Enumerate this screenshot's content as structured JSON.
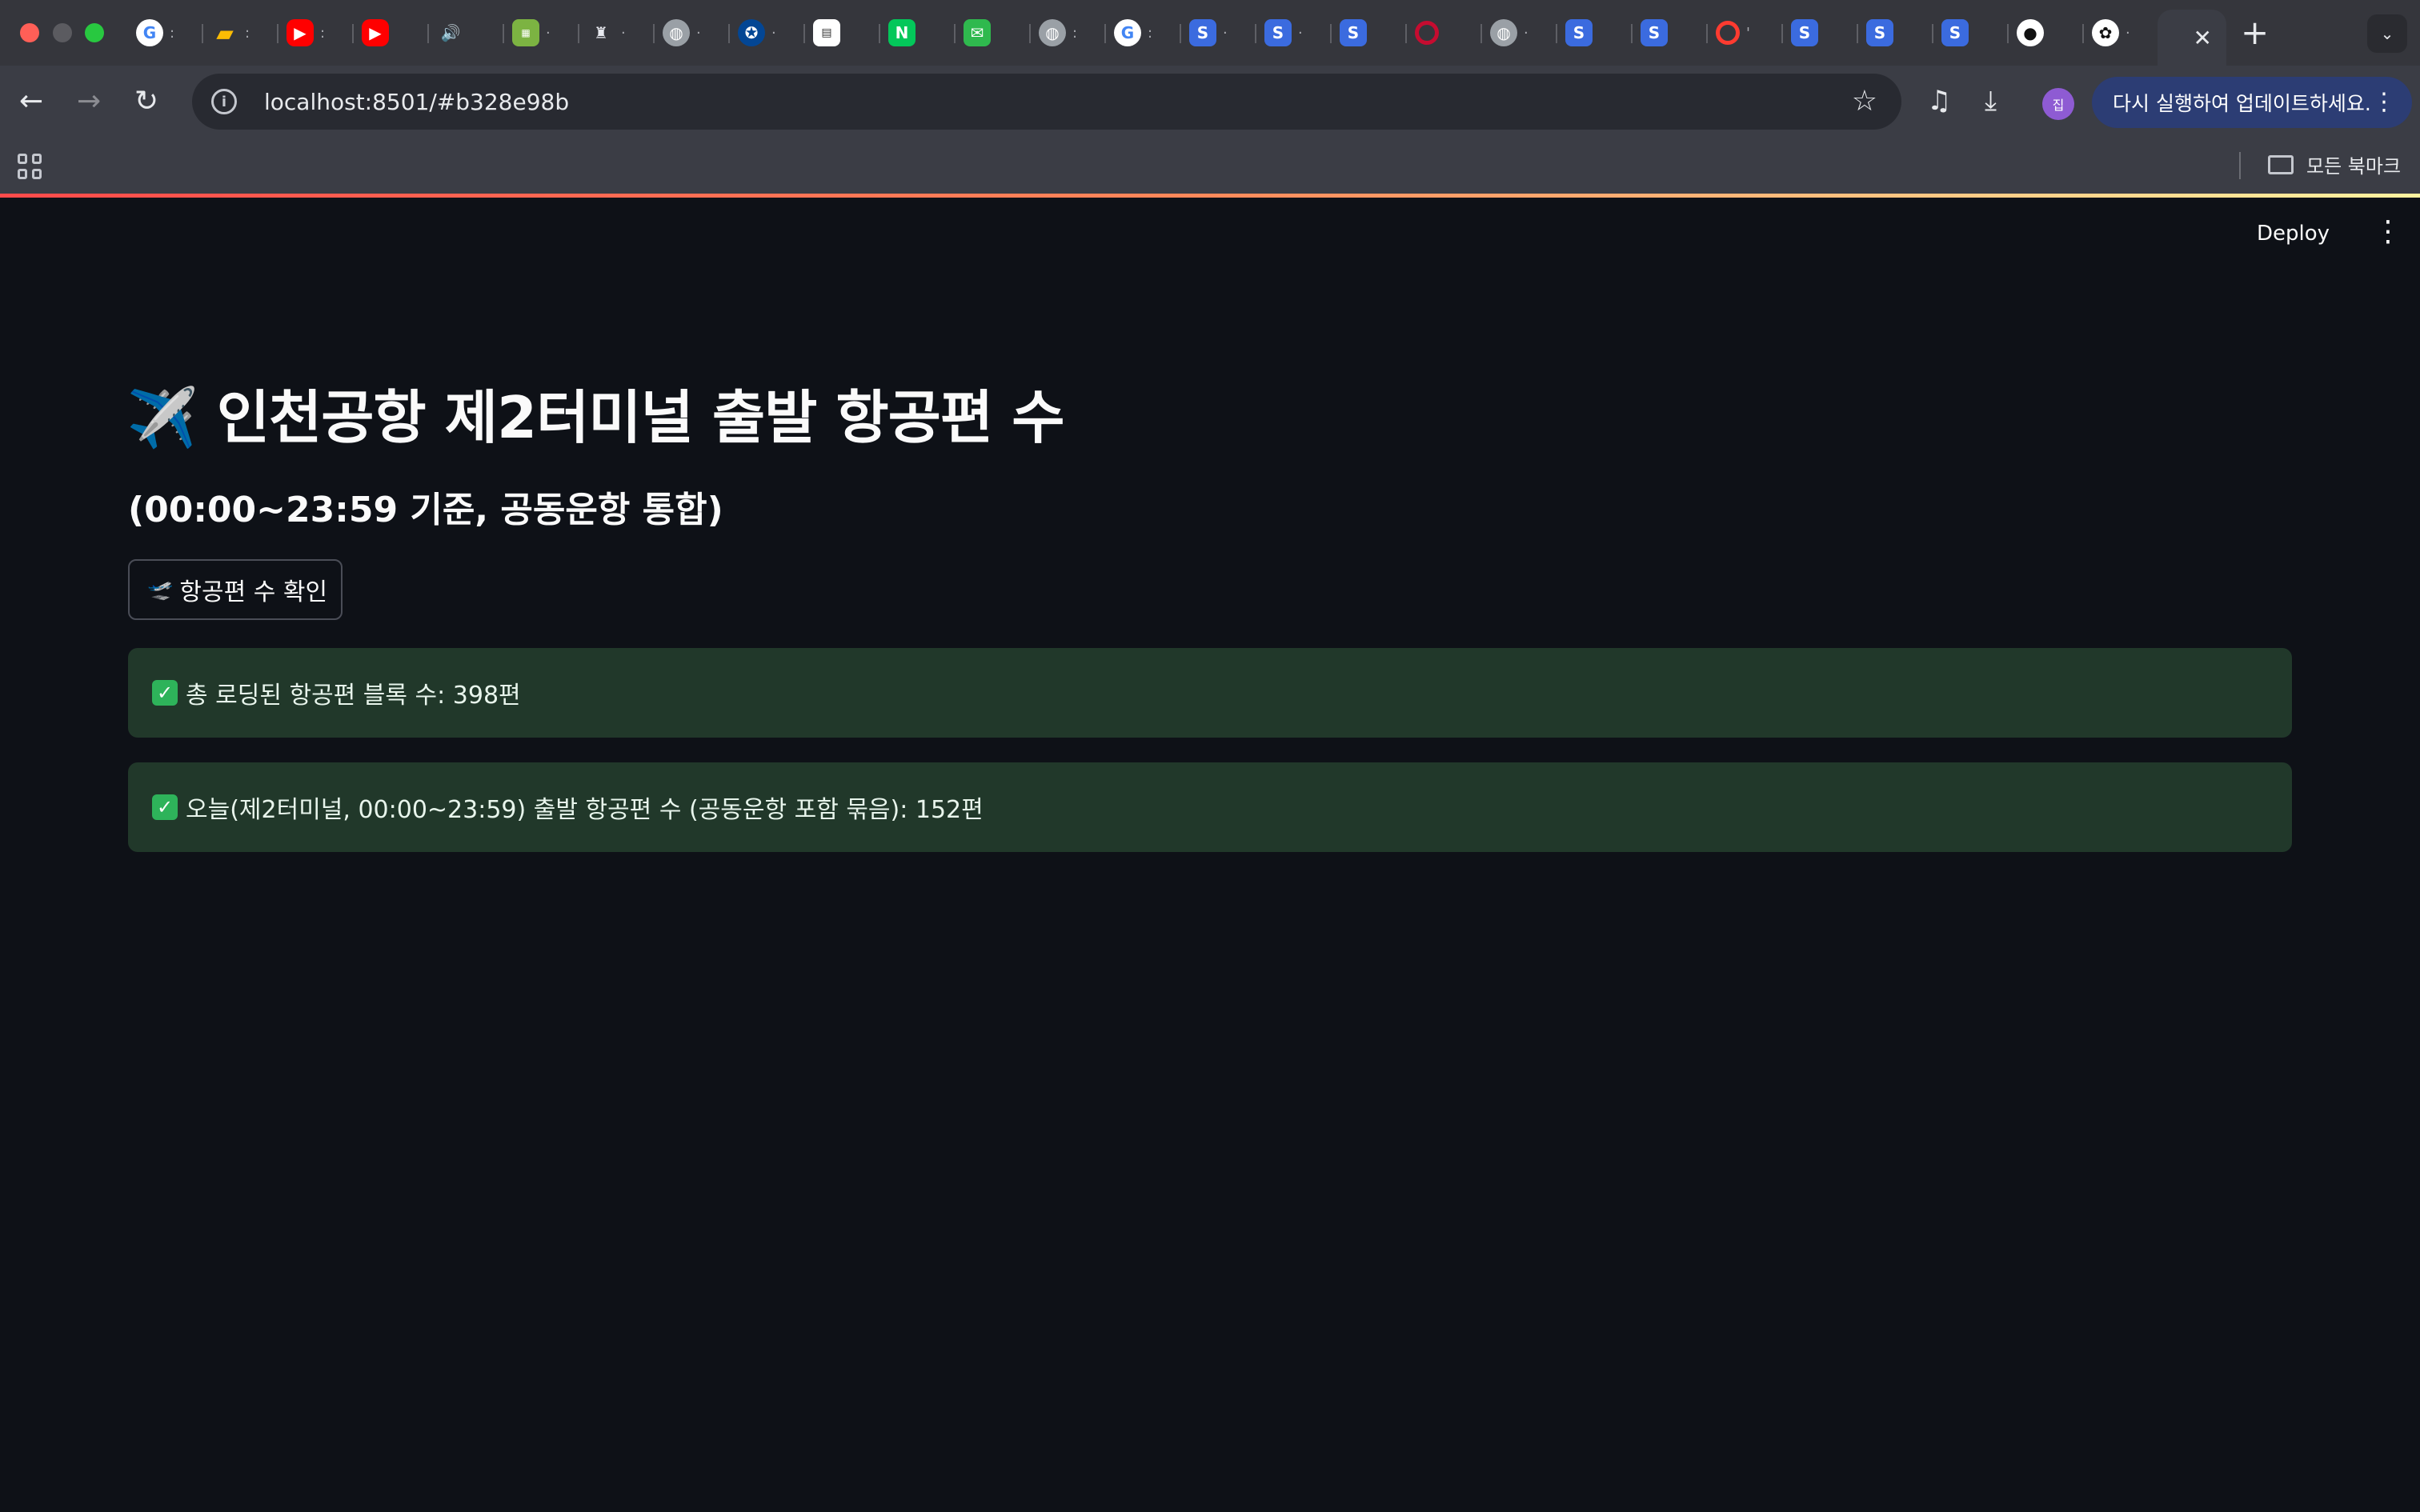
{
  "browser": {
    "tabs": [
      {
        "icon": "google-icon",
        "glyph": "G"
      },
      {
        "icon": "google-ads-icon",
        "glyph": "▰"
      },
      {
        "icon": "youtube-icon",
        "glyph": "▶"
      },
      {
        "icon": "youtube-icon",
        "glyph": "▶"
      },
      {
        "icon": "speaker-icon",
        "glyph": "🔊"
      },
      {
        "icon": "green-app-icon",
        "glyph": "▦"
      },
      {
        "icon": "spurs-icon",
        "glyph": "♜"
      },
      {
        "icon": "globe-icon",
        "glyph": "◍"
      },
      {
        "icon": "chelsea-icon",
        "glyph": "✪"
      },
      {
        "icon": "document-icon",
        "glyph": "▤"
      },
      {
        "icon": "naver-icon",
        "glyph": "N"
      },
      {
        "icon": "mail-icon",
        "glyph": "✉"
      },
      {
        "icon": "globe-icon",
        "glyph": "◍"
      },
      {
        "icon": "google-icon",
        "glyph": "G"
      },
      {
        "icon": "s-app-icon",
        "glyph": "S"
      },
      {
        "icon": "s-app-icon",
        "glyph": "S"
      },
      {
        "icon": "s-app-icon",
        "glyph": "S"
      },
      {
        "icon": "korean-circle-icon",
        "glyph": ""
      },
      {
        "icon": "globe-icon",
        "glyph": "◍"
      },
      {
        "icon": "s-app-icon",
        "glyph": "S"
      },
      {
        "icon": "s-app-icon",
        "glyph": "S"
      },
      {
        "icon": "red-ring-icon",
        "glyph": ""
      },
      {
        "icon": "s-app-icon",
        "glyph": "S"
      },
      {
        "icon": "s-app-icon",
        "glyph": "S"
      },
      {
        "icon": "s-app-icon",
        "glyph": "S"
      },
      {
        "icon": "github-icon",
        "glyph": "●"
      },
      {
        "icon": "openai-icon",
        "glyph": "✿"
      }
    ],
    "active_tab_close": "✕",
    "new_tab": "+",
    "url": "localhost:8501/#b328e98b",
    "update_label": "다시 실행하여 업데이트하세요.",
    "profile_initial": "집",
    "bookmarks_all": "모든 북마크"
  },
  "header": {
    "deploy_label": "Deploy"
  },
  "main": {
    "title": "✈️ 인천공항 제2터미널 출발 항공편 수",
    "subtitle": "(00:00~23:59 기준, 공동운항 통합)",
    "check_button": {
      "icon": "🛫",
      "label": "항공편 수 확인"
    },
    "alerts": [
      {
        "text": "총 로딩된 항공편 블록 수: 398편"
      },
      {
        "text": "오늘(제2터미널, 00:00~23:59) 출발 항공편 수 (공동운항 포함 묶음): 152편"
      }
    ]
  },
  "colors": {
    "background": "#0e1117",
    "success_bg": "#21382a",
    "accent_red": "#ff4b4b"
  }
}
